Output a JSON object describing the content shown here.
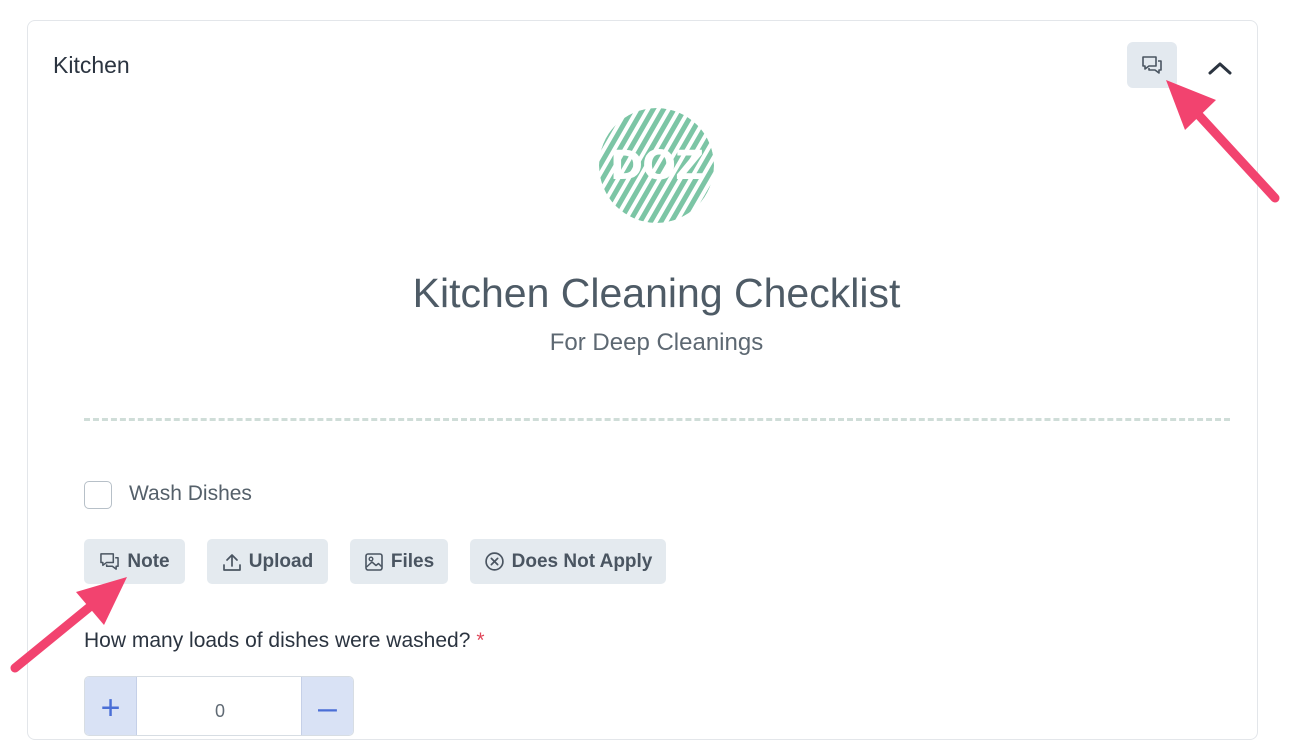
{
  "section": {
    "title": "Kitchen",
    "comment_icon": "comment-icon",
    "collapse_icon": "chevron-up-icon"
  },
  "logo": {
    "text": "DOZ",
    "color": "#7cc5a5"
  },
  "document": {
    "title": "Kitchen Cleaning Checklist",
    "subtitle": "For Deep Cleanings"
  },
  "task": {
    "label": "Wash Dishes",
    "checked": false
  },
  "actions": [
    {
      "label": "Note",
      "icon": "comment-icon"
    },
    {
      "label": "Upload",
      "icon": "upload-icon"
    },
    {
      "label": "Files",
      "icon": "image-icon"
    },
    {
      "label": "Does Not Apply",
      "icon": "x-circle-icon"
    }
  ],
  "question": {
    "label": "How many loads of dishes were washed?",
    "required_mark": "*",
    "value": "0",
    "plus_label": "+",
    "minus_label": "–"
  },
  "colors": {
    "annotation_arrow": "#f2436f",
    "accent_blue": "#4b6fd6",
    "required_red": "#e0475a"
  }
}
